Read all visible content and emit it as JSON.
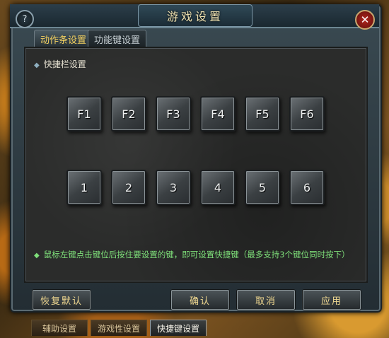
{
  "window": {
    "title": "游戏设置",
    "help_icon": "?",
    "close_icon": "✕"
  },
  "tabs": [
    {
      "label": "动作条设置",
      "active": true
    },
    {
      "label": "功能键设置",
      "active": false
    }
  ],
  "section": {
    "title": "快捷栏设置",
    "row1": [
      "F1",
      "F2",
      "F3",
      "F4",
      "F5",
      "F6"
    ],
    "row2": [
      "1",
      "2",
      "3",
      "4",
      "5",
      "6"
    ]
  },
  "hint": "鼠标左键点击键位后按住要设置的键，即可设置快捷键（最多支持3个键位同时按下）",
  "buttons": {
    "reset": "恢复默认",
    "confirm": "确认",
    "cancel": "取消",
    "apply": "应用"
  },
  "bottom_tabs": [
    {
      "label": "辅助设置",
      "active": false
    },
    {
      "label": "游戏性设置",
      "active": false
    },
    {
      "label": "快捷键设置",
      "active": true
    }
  ],
  "colors": {
    "accent": "#f2d060",
    "hint": "#7fe07a"
  }
}
